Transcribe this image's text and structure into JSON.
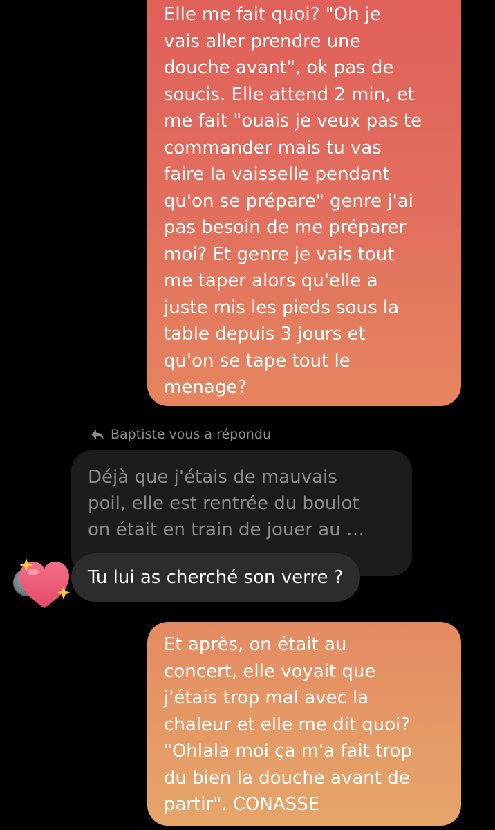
{
  "conversation": {
    "messages": [
      {
        "sender": "me",
        "text": "Elle me fait quoi? \"Oh je\nvais aller prendre une\ndouche avant\", ok pas de\nsoucis. Elle attend 2 min, et\nme fait \"ouais je veux pas te\ncommander mais tu vas\nfaire la vaisselle pendant\nqu'on se prépare\" genre j'ai\npas besoin de me préparer\nmoi? Et genre je vais tout\nme taper alors qu'elle a\njuste mis les pieds sous la\ntable depuis 3 jours et\nqu'on se tape tout le\nmenage?"
      },
      {
        "sender": "Baptiste",
        "reply_label": "Baptiste vous a répondu",
        "quoted_text": "Déjà que j'étais de mauvais\npoil, elle est rentrée du boulot\non était en train de jouer au …",
        "text": "Tu lui as cherché son verre ?",
        "reaction": "sparkling-heart"
      },
      {
        "sender": "me",
        "text": "Et après, on était au\nconcert, elle voyait que\nj'étais trop mal avec la\nchaleur et elle me dit quoi?\n\"Ohlala moi ça m'a fait trop\ndu bien la douche avant de\npartir\". CONASSE"
      }
    ]
  },
  "icons": {
    "reply_indicator": "reply-arrow-icon",
    "reaction": "sparkling-heart-icon"
  },
  "colors": {
    "background": "#000000",
    "outgoing_bubble_top": "#e0605a",
    "outgoing_bubble_bottom": "#e4a56a",
    "incoming_bubble": "#2c2c2c",
    "quoted_bubble": "#1c1c1c",
    "secondary_text": "#8d8d8d"
  }
}
